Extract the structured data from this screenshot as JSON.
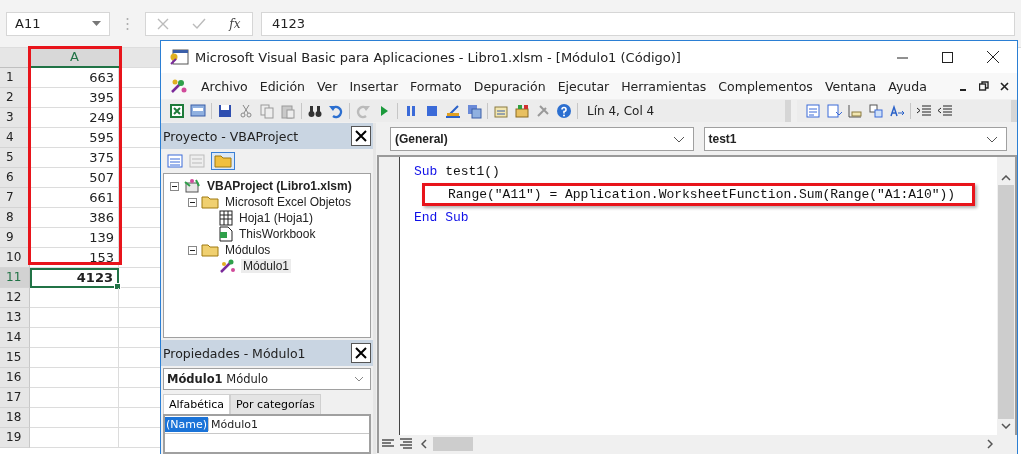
{
  "excel": {
    "name_box": "A11",
    "function_label": "fx",
    "formula_value": "4123",
    "column_header": "A",
    "rows": [
      {
        "number": "1",
        "value": "663",
        "selected": false
      },
      {
        "number": "2",
        "value": "395",
        "selected": false
      },
      {
        "number": "3",
        "value": "249",
        "selected": false
      },
      {
        "number": "4",
        "value": "595",
        "selected": false
      },
      {
        "number": "5",
        "value": "375",
        "selected": false
      },
      {
        "number": "6",
        "value": "507",
        "selected": false
      },
      {
        "number": "7",
        "value": "661",
        "selected": false
      },
      {
        "number": "8",
        "value": "386",
        "selected": false
      },
      {
        "number": "9",
        "value": "139",
        "selected": false
      },
      {
        "number": "10",
        "value": "153",
        "selected": false
      },
      {
        "number": "11",
        "value": "4123",
        "selected": true
      },
      {
        "number": "12",
        "selected": false
      },
      {
        "number": "13",
        "selected": false
      },
      {
        "number": "14",
        "selected": false
      },
      {
        "number": "15",
        "selected": false
      },
      {
        "number": "16",
        "selected": false
      },
      {
        "number": "17",
        "selected": false
      },
      {
        "number": "18",
        "selected": false
      },
      {
        "number": "19",
        "selected": false
      }
    ]
  },
  "vba": {
    "title": "Microsoft Visual Basic para Aplicaciones - Libro1.xlsm - [Módulo1 (Código)]",
    "menu": [
      "Archivo",
      "Edición",
      "Ver",
      "Insertar",
      "Formato",
      "Depuración",
      "Ejecutar",
      "Herramientas",
      "Complementos",
      "Ventana",
      "Ayuda"
    ],
    "position": "Lín 4, Col 4",
    "project_panel": {
      "title": "Proyecto - VBAProject",
      "tree": [
        {
          "label": "VBAProject (Libro1.xlsm)",
          "kind": "project",
          "expanded": true,
          "selected": false,
          "children": [
            {
              "label": "Microsoft Excel Objetos",
              "kind": "folder",
              "expanded": true,
              "selected": false,
              "children": [
                {
                  "label": "Hoja1 (Hoja1)",
                  "kind": "sheet",
                  "selected": false
                },
                {
                  "label": "ThisWorkbook",
                  "kind": "workbook",
                  "selected": false
                }
              ]
            },
            {
              "label": "Módulos",
              "kind": "folder",
              "expanded": true,
              "selected": false,
              "children": [
                {
                  "label": "Módulo1",
                  "kind": "module",
                  "selected": true
                }
              ]
            }
          ]
        }
      ]
    },
    "properties_panel": {
      "title": "Propiedades - Módulo1",
      "object_name": "Módulo1",
      "object_type": "Módulo",
      "tabs": [
        {
          "label": "Alfabética",
          "selected": true
        },
        {
          "label": "Por categorías",
          "selected": false
        }
      ],
      "rows": [
        {
          "name": "(Name)",
          "value": "Módulo1",
          "selected": true
        }
      ]
    },
    "code": {
      "object": "(General)",
      "procedure": "test1",
      "lines": [
        {
          "indented": false,
          "highlighted": false,
          "tokens": [
            {
              "text": "Sub",
              "kind": "keyword"
            },
            {
              "text": " test1()",
              "kind": "plain"
            }
          ]
        },
        {
          "indented": true,
          "highlighted": true,
          "tokens": [
            {
              "text": "Range(\"A11\") = Application.WorksheetFunction.Sum(Range(\"A1:A10\"))",
              "kind": "plain"
            }
          ]
        },
        {
          "indented": false,
          "highlighted": false,
          "tokens": [
            {
              "text": "End Sub",
              "kind": "keyword"
            }
          ]
        }
      ]
    }
  }
}
